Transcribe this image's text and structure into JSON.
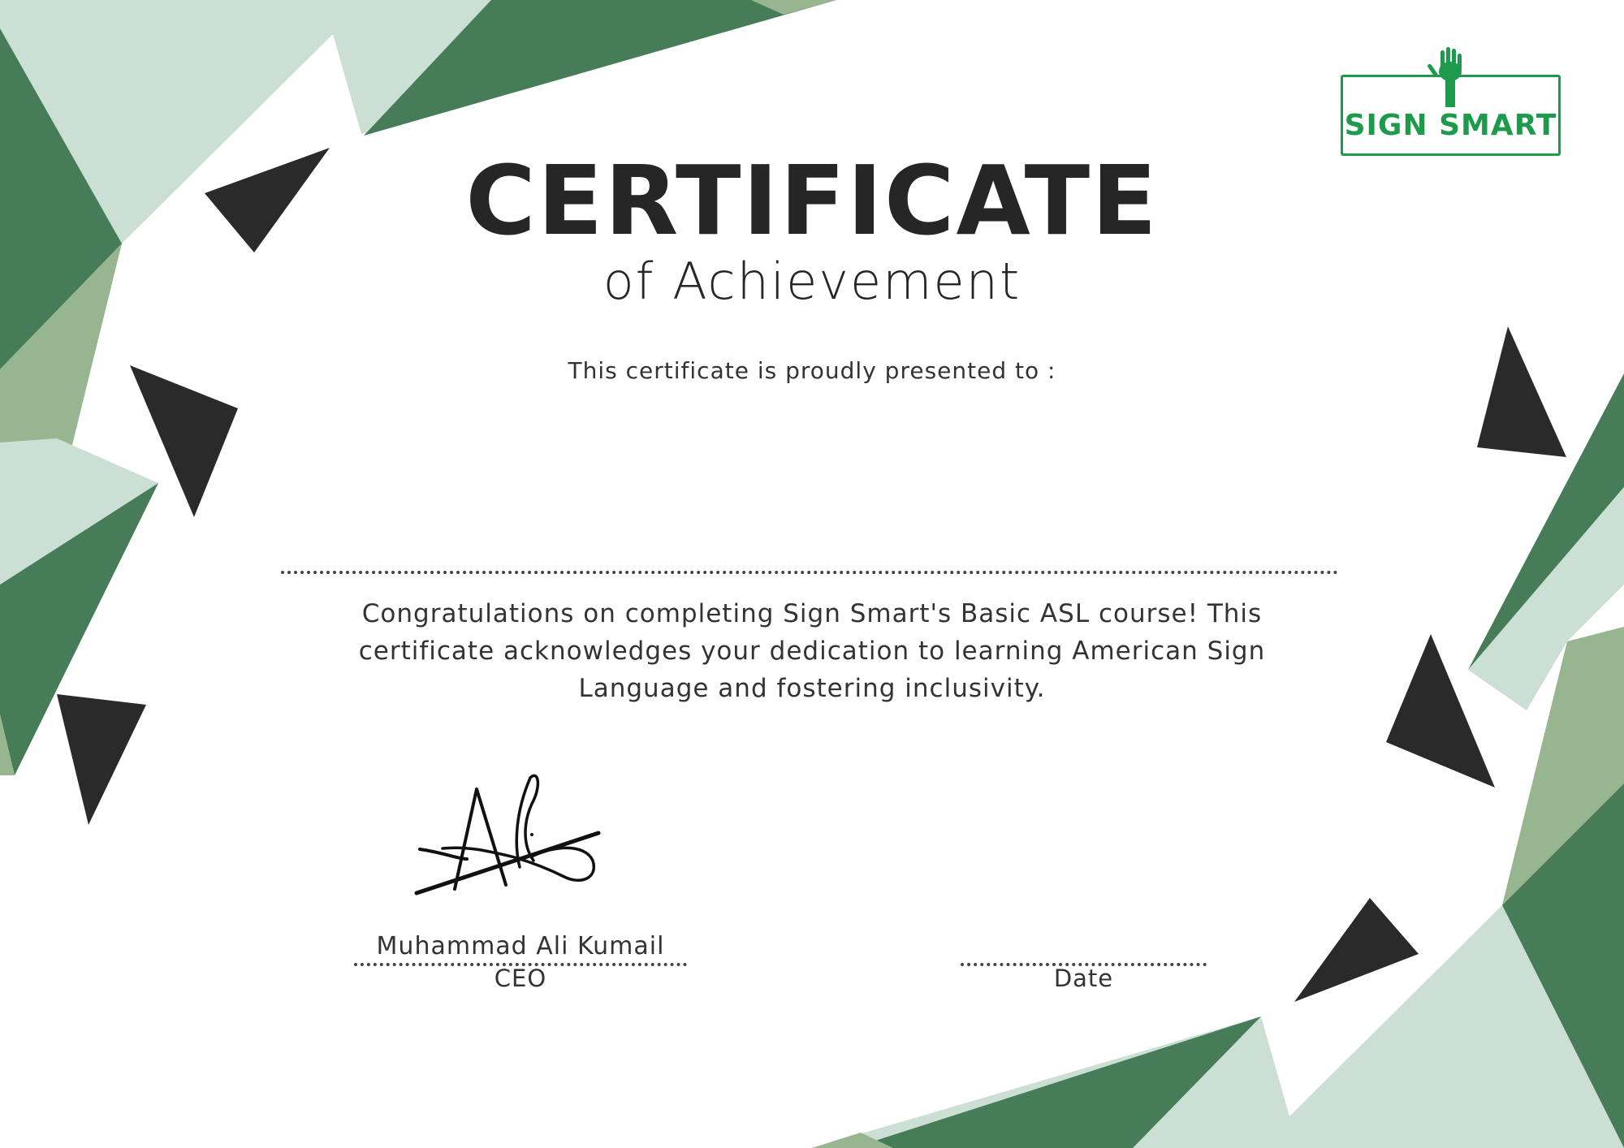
{
  "colors": {
    "dark_green": "#467d58",
    "mid_green": "#97b68f",
    "light_green": "#cbdfd4",
    "triangle_dark": "#2a2a2a",
    "brand_green": "#1d9a4b",
    "text": "#262626"
  },
  "logo": {
    "text": "SIGN SMART",
    "icon": "raised-hand-icon"
  },
  "certificate": {
    "title": "CERTIFICATE",
    "subtitle": "of Achievement",
    "presented_to": "This certificate is proudly presented to :",
    "recipient_name": "",
    "body": "Congratulations on completing Sign Smart's Basic ASL course! This certificate acknowledges your dedication to learning American Sign Language and fostering inclusivity."
  },
  "signature": {
    "name": "Muhammad Ali Kumail",
    "role": "CEO"
  },
  "date": {
    "value": "",
    "label": "Date"
  }
}
